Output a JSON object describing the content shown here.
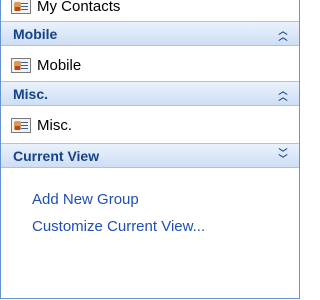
{
  "contacts_pane": {
    "top_item": {
      "label": "My Contacts",
      "icon": "contact-card-icon"
    },
    "sections": [
      {
        "title": "Mobile",
        "state": "expanded",
        "items": [
          {
            "label": "Mobile",
            "icon": "contact-card-icon"
          }
        ]
      },
      {
        "title": "Misc.",
        "state": "expanded",
        "items": [
          {
            "label": "Misc.",
            "icon": "contact-card-icon"
          }
        ]
      }
    ],
    "current_view": {
      "title": "Current View",
      "state": "collapsed",
      "links": [
        "Add New Group",
        "Customize Current View..."
      ]
    }
  },
  "colors": {
    "header_text": "#15428b",
    "header_bg_top": "#e9f1fc",
    "header_bg_bottom": "#cfdef5",
    "link_text": "#1f4eb4",
    "border": "#6593cf"
  }
}
